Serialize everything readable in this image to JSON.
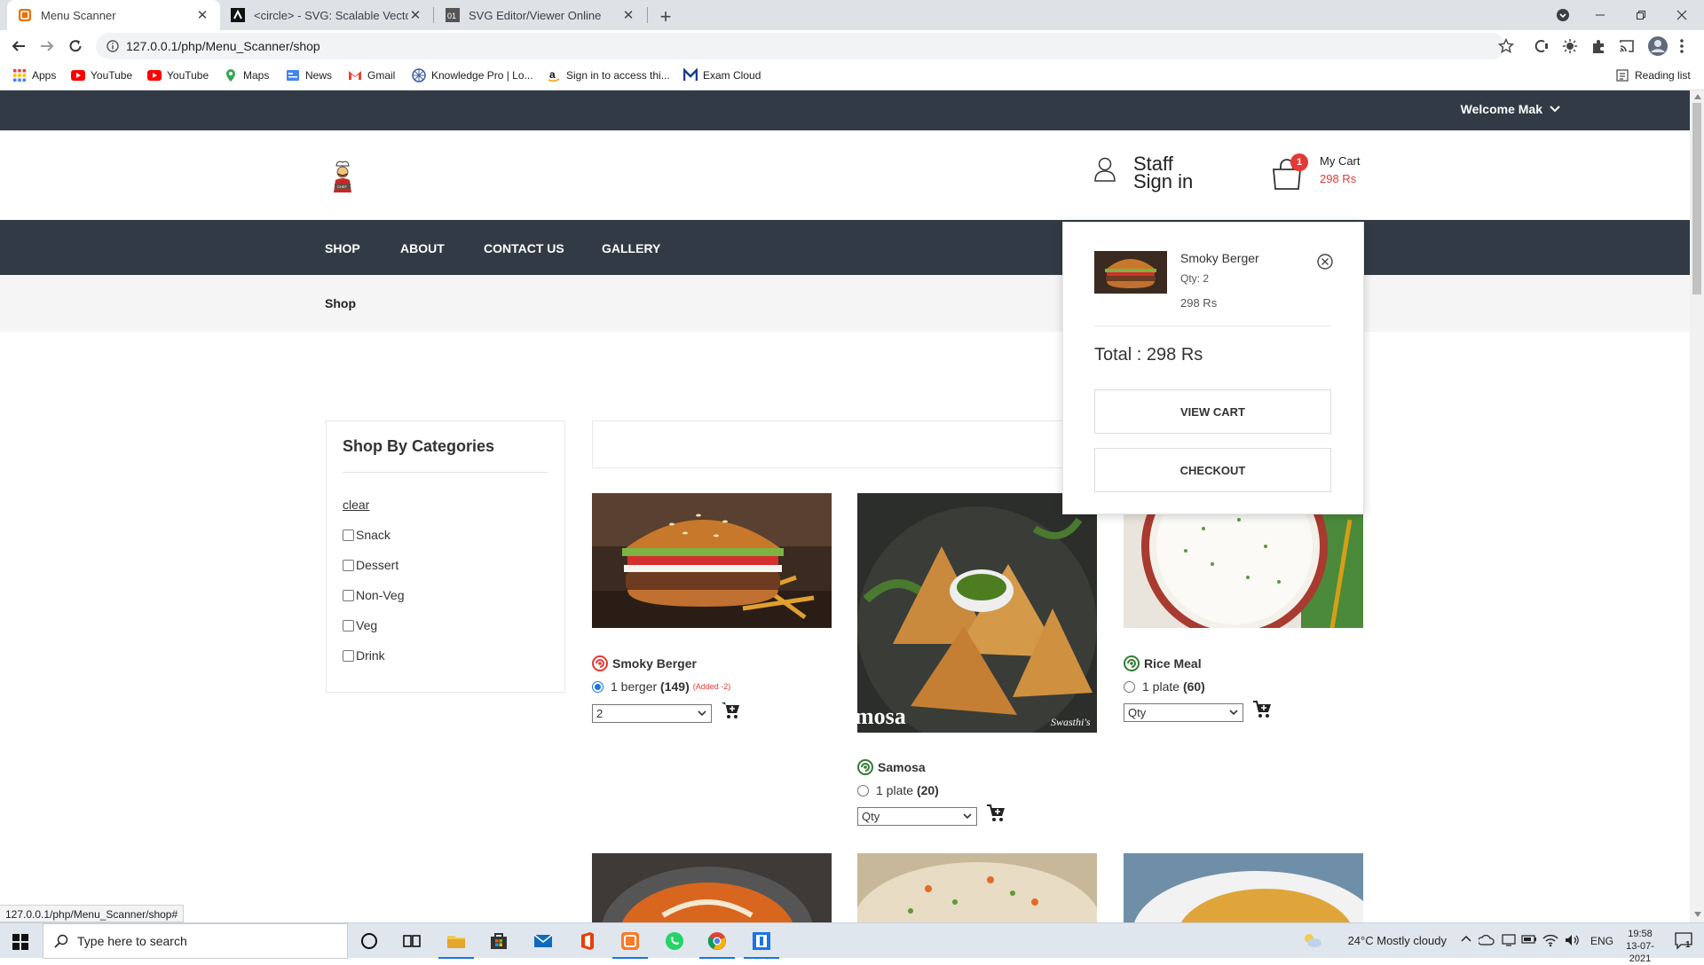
{
  "browser": {
    "tabs": [
      {
        "title": "Menu Scanner",
        "favicon": "menu-scanner-favicon",
        "active": true
      },
      {
        "title": "<circle> - SVG: Scalable Vector G",
        "favicon": "mdn-favicon",
        "active": false
      },
      {
        "title": "SVG Editor/Viewer Online",
        "favicon": "svg-editor-favicon",
        "active": false
      }
    ],
    "address": "127.0.0.1/php/Menu_Scanner/shop",
    "bookmarks": [
      "Apps",
      "YouTube",
      "YouTube",
      "Maps",
      "News",
      "Gmail",
      "Knowledge Pro | Lo...",
      "Sign in to access thi...",
      "Exam Cloud"
    ],
    "reading_list": "Reading list",
    "status_url": "127.0.0.1/php/Menu_Scanner/shop#"
  },
  "site": {
    "welcome": "Welcome Mak",
    "staff": {
      "line1": "Staff",
      "line2": "Sign in"
    },
    "cart": {
      "label": "My Cart",
      "amount": "298 Rs",
      "count": "1"
    },
    "nav": [
      "SHOP",
      "ABOUT",
      "CONTACT US",
      "GALLERY"
    ],
    "breadcrumb": "Shop",
    "categories": {
      "title": "Shop By Categories",
      "clear": "clear",
      "items": [
        "Snack",
        "Dessert",
        "Non-Veg",
        "Veg",
        "Drink"
      ]
    },
    "products": [
      {
        "name": "Smoky Berger",
        "variant": "1 berger",
        "price": "(149)",
        "added": "(Added -2)",
        "qty": "2",
        "selected": true
      },
      {
        "name": "Samosa",
        "variant": "1 plate",
        "price": "(20)",
        "added": "",
        "qty": "Qty",
        "selected": false,
        "image_caption": "mosa",
        "image_watermark": "Swasthi's"
      },
      {
        "name": "Rice Meal",
        "variant": "1 plate",
        "price": "(60)",
        "added": "",
        "qty": "Qty",
        "selected": false
      }
    ],
    "minicart": {
      "item_name": "Smoky Berger",
      "item_qty": "Qty: 2",
      "item_price": "298 Rs",
      "total": "Total : 298 Rs",
      "view_cart": "VIEW CART",
      "checkout": "CHECKOUT"
    }
  },
  "taskbar": {
    "search_placeholder": "Type here to search",
    "weather": "24°C  Mostly cloudy",
    "language": "ENG",
    "time": "19:58",
    "date": "13-07-2021",
    "notifications": "1"
  },
  "colors": {
    "dark_bar": "#323a45",
    "price_red": "#e53935",
    "badge_red": "#e53935"
  }
}
